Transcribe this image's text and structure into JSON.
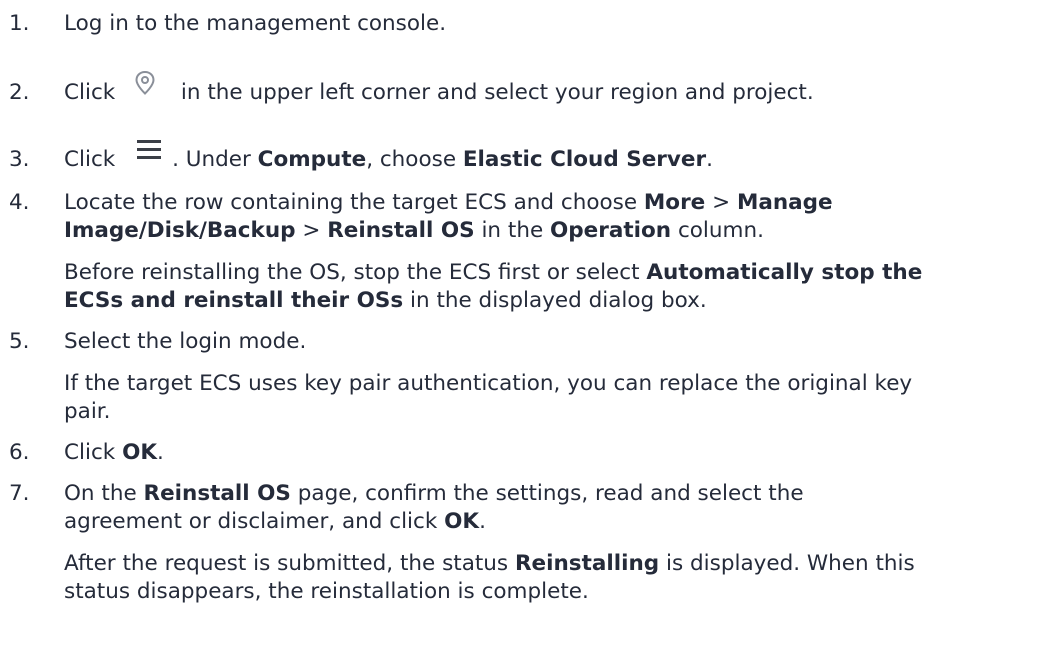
{
  "steps": [
    {
      "num": "1.",
      "lines": [
        [
          "Log in to the management console."
        ]
      ]
    },
    {
      "num": "2.",
      "pre": "Click",
      "icon": "location-pin-icon",
      "post": "in the upper left corner and select your region and project."
    },
    {
      "num": "3.",
      "pre": "Click",
      "icon": "hamburger-menu-icon",
      "post_a": ". Under ",
      "post_b": "Compute",
      "post_c": ", choose ",
      "post_d": "Elastic Cloud Server",
      "post_e": "."
    },
    {
      "num": "4.",
      "l1_a": "Locate the row containing the target ECS and choose ",
      "l1_b": "More",
      "l1_c": " > ",
      "l1_d": "Manage",
      "l2_a": "Image/Disk/Backup",
      "l2_b": " > ",
      "l2_c": "Reinstall OS",
      "l2_d": " in the ",
      "l2_e": "Operation",
      "l2_f": " column.",
      "l3_a": "Before reinstalling the OS, stop the ECS first or select ",
      "l3_b": "Automatically stop the",
      "l4_a": "ECSs and reinstall their OSs",
      "l4_b": " in the displayed dialog box."
    },
    {
      "num": "5.",
      "l1": "Select the login mode.",
      "l2": "If the target ECS uses key pair authentication, you can replace the original key",
      "l3": "pair."
    },
    {
      "num": "6.",
      "l1_a": "Click ",
      "l1_b": "OK",
      "l1_c": "."
    },
    {
      "num": "7.",
      "l1_a": "On the ",
      "l1_b": "Reinstall OS",
      "l1_c": " page, confirm the settings, read and select the",
      "l2_a": "agreement or disclaimer, and click ",
      "l2_b": "OK",
      "l2_c": ".",
      "l3_a": "After the request is submitted, the status ",
      "l3_b": "Reinstalling",
      "l3_c": " is displayed. When this",
      "l4": "status disappears, the reinstallation is complete."
    }
  ]
}
